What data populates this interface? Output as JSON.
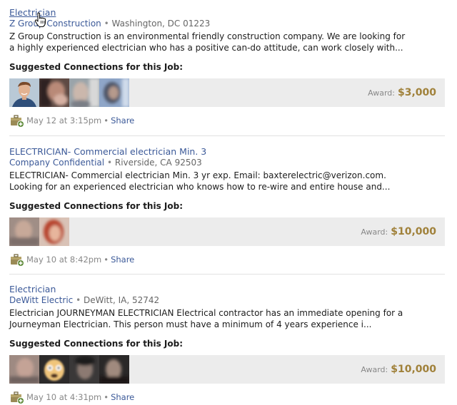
{
  "jobs": [
    {
      "title": "Electrician",
      "company": "Z Group Construction",
      "location": "Washington, DC 01223",
      "desc_line1": "Z Group Construction is an environmental friendly construction company. We are looking for",
      "desc_line2": "a highly experienced electrician who has a positive can-do attitude, can work closely with...",
      "suggested_label": "Suggested Connections for this Job:",
      "award_label": "Award:",
      "award_value": "$3,000",
      "date": "May 12 at 3:15pm",
      "share": "Share"
    },
    {
      "title": "ELECTRICIAN- Commercial electrician Min. 3",
      "company": "Company Confidential",
      "location": "Riverside, CA 92503",
      "desc_line1": "ELECTRICIAN- Commercial electrician Min. 3 yr exp. Email: baxterelectric@verizon.com.",
      "desc_line2": "Looking for an experienced electrician who knows how to re-wire and entire house and...",
      "suggested_label": "Suggested Connections for this Job:",
      "award_label": "Award:",
      "award_value": "$10,000",
      "date": "May 10 at 8:42pm",
      "share": "Share"
    },
    {
      "title": "Electrician",
      "company": "DeWitt Electric",
      "location": "DeWitt, IA, 52742",
      "desc_line1": "Electrician JOURNEYMAN ELECTRICIAN Electrical contractor has an immediate opening for a",
      "desc_line2": "Journeyman Electrician. This person must have a minimum of 4 years experience i...",
      "suggested_label": "Suggested Connections for this Job:",
      "award_label": "Award:",
      "award_value": "$10,000",
      "date": "May 10 at 4:31pm",
      "share": "Share"
    }
  ],
  "separator": "•",
  "colors": {
    "link": "#3b5998",
    "award": "#a0813a",
    "bar": "#ececec"
  }
}
